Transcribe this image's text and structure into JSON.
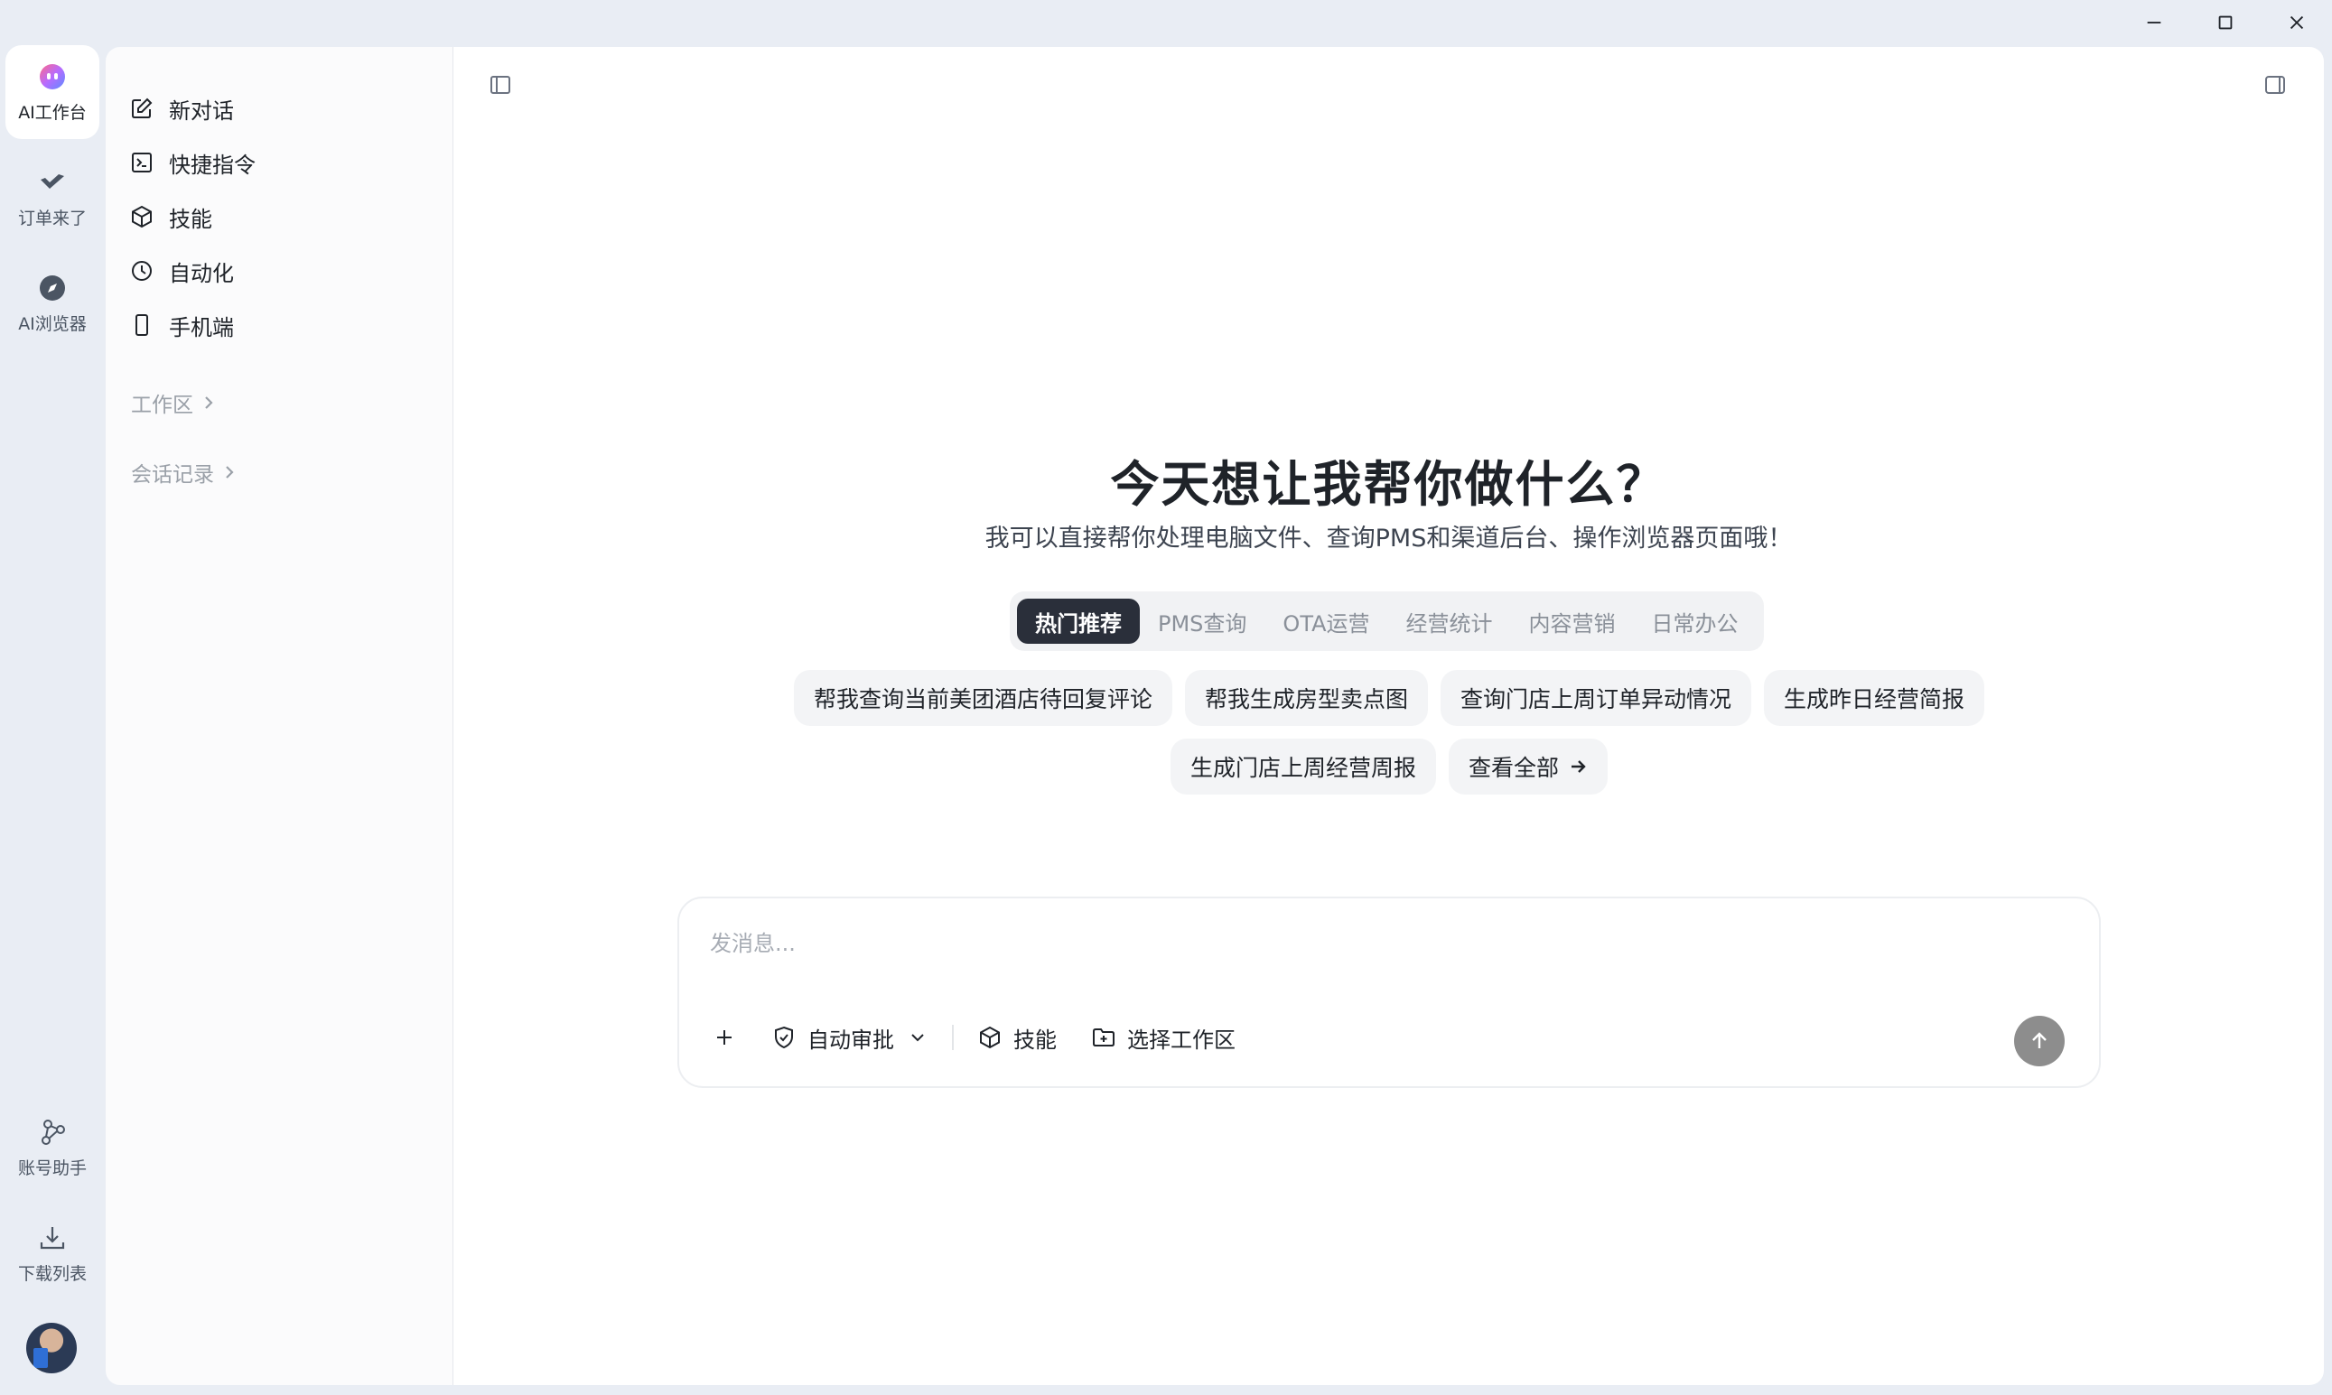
{
  "window": {
    "controls": [
      "minimize-icon",
      "maximize-icon",
      "close-icon"
    ]
  },
  "rail": {
    "items": [
      {
        "label": "AI工作台",
        "icon": "ai-robot-icon",
        "active": true
      },
      {
        "label": "订单来了",
        "icon": "order-logo-icon",
        "active": false
      },
      {
        "label": "AI浏览器",
        "icon": "compass-icon",
        "active": false
      },
      {
        "label": "账号助手",
        "icon": "network-icon",
        "active": false
      },
      {
        "label": "下载列表",
        "icon": "download-icon",
        "active": false
      }
    ]
  },
  "sidebar": {
    "menu": [
      {
        "label": "新对话",
        "icon": "edit-icon"
      },
      {
        "label": "快捷指令",
        "icon": "terminal-icon"
      },
      {
        "label": "技能",
        "icon": "cube-icon"
      },
      {
        "label": "自动化",
        "icon": "clock-icon"
      },
      {
        "label": "手机端",
        "icon": "phone-icon"
      }
    ],
    "sections": [
      {
        "label": "工作区"
      },
      {
        "label": "会话记录"
      }
    ]
  },
  "main": {
    "title": "今天想让我帮你做什么？",
    "subtitle": "我可以直接帮你处理电脑文件、查询PMS和渠道后台、操作浏览器页面哦！",
    "tabs": [
      {
        "label": "热门推荐",
        "active": true
      },
      {
        "label": "PMS查询",
        "active": false
      },
      {
        "label": "OTA运营",
        "active": false
      },
      {
        "label": "经营统计",
        "active": false
      },
      {
        "label": "内容营销",
        "active": false
      },
      {
        "label": "日常办公",
        "active": false
      }
    ],
    "suggestions": [
      "帮我查询当前美团酒店待回复评论",
      "帮我生成房型卖点图",
      "查询门店上周订单异动情况",
      "生成昨日经营简报",
      "生成门店上周经营周报"
    ],
    "view_all": "查看全部"
  },
  "composer": {
    "placeholder": "发消息...",
    "auto_approve": "自动审批",
    "skills": "技能",
    "workspace": "选择工作区"
  }
}
